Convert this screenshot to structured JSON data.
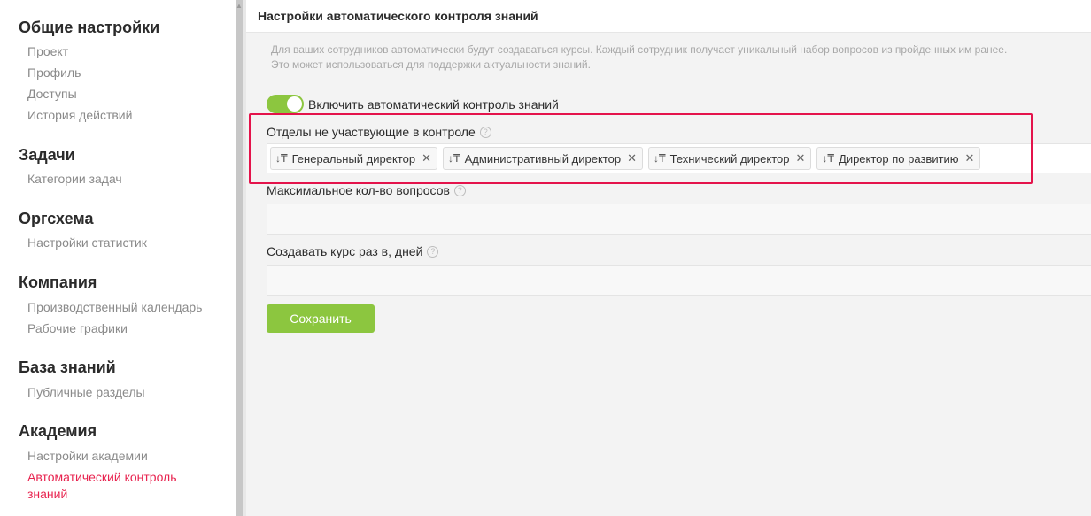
{
  "sidebar": {
    "sections": [
      {
        "title": "Общие настройки",
        "items": [
          "Проект",
          "Профиль",
          "Доступы",
          "История действий"
        ]
      },
      {
        "title": "Задачи",
        "items": [
          "Категории задач"
        ]
      },
      {
        "title": "Оргсхема",
        "items": [
          "Настройки статистик"
        ]
      },
      {
        "title": "Компания",
        "items": [
          "Производственный календарь",
          "Рабочие графики"
        ]
      },
      {
        "title": "База знаний",
        "items": [
          "Публичные разделы"
        ]
      },
      {
        "title": "Академия",
        "items": [
          "Настройки академии",
          "Автоматический контроль знаний"
        ]
      }
    ],
    "active_item": "Автоматический контроль знаний"
  },
  "main": {
    "title": "Настройки автоматического контроля знаний",
    "description_line1": "Для ваших сотрудников автоматически будут создаваться курсы. Каждый сотрудник получает уникальный набор вопросов из пройденных им ранее.",
    "description_line2": "Это может использоваться для поддержки актуальности знаний.",
    "toggle": {
      "label": "Включить автоматический контроль знаний",
      "enabled": true
    },
    "excluded_departments": {
      "label": "Отделы не участвующие в контроле",
      "tags": [
        "Генеральный директор",
        "Административный директор",
        "Технический директор",
        "Директор по развитию"
      ]
    },
    "max_questions": {
      "label": "Максимальное кол-во вопросов",
      "value": ""
    },
    "course_interval": {
      "label": "Создавать курс раз в, дней",
      "value": ""
    },
    "save_label": "Сохранить"
  },
  "colors": {
    "accent_green": "#8cc63f",
    "active_link": "#e8234f",
    "highlight_border": "#e4134b"
  },
  "icons": {
    "help": "question-circle-icon",
    "sort": "sort-down-icon",
    "remove": "close-icon"
  }
}
